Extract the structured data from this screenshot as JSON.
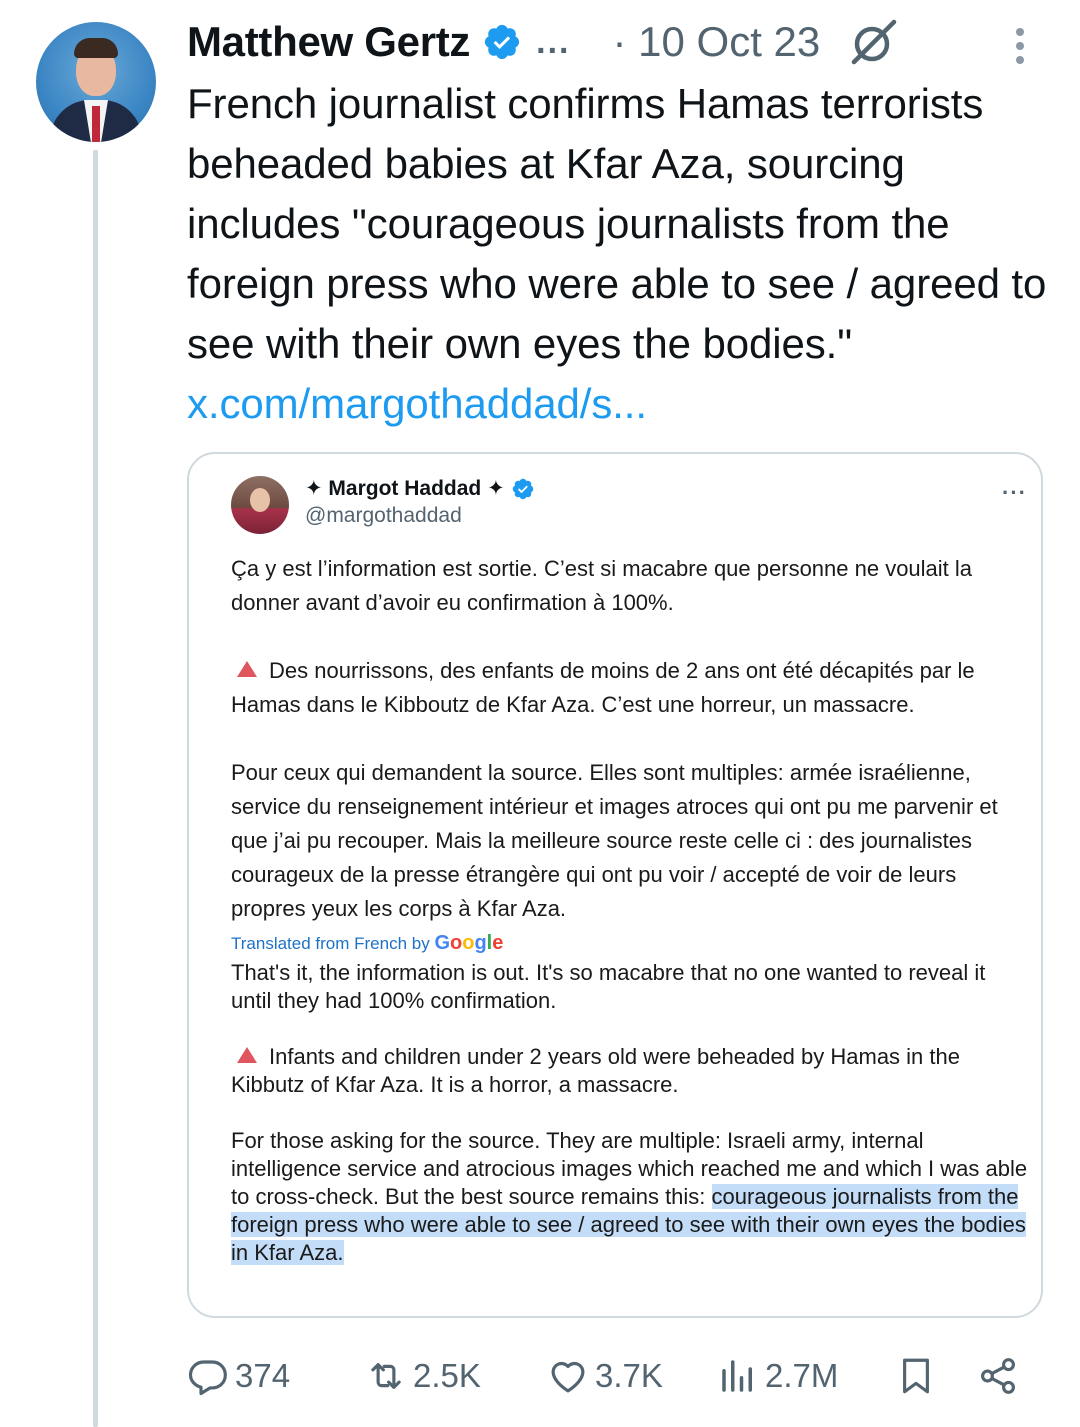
{
  "tweet": {
    "author_name": "Matthew Gertz",
    "ellipsis": "...",
    "date": "· 10 Oct 23",
    "text": "French journalist confirms Hamas terrorists beheaded babies at Kfar Aza, sourcing includes \"courageous journalists from the foreign press who were able to see / agreed to see with their own eyes the bodies.\" ",
    "link": "x.com/margothaddad/s...",
    "icons": {
      "verified": "verified-badge-icon",
      "grok": "grok-icon",
      "more": "more-vertical-icon"
    }
  },
  "quote": {
    "author_name": "✦ Margot Haddad ✦",
    "handle": "@margothaddad",
    "more": "···",
    "p1": "Ça y est l’information est sortie. C’est si macabre que personne ne voulait la donner avant d’avoir eu confirmation à 100%.",
    "p2": "Des nourrissons, des enfants de moins de 2 ans ont été décapités par le Hamas dans le Kibboutz de Kfar Aza. C’est une horreur, un massacre.",
    "p3": "Pour ceux qui demandent la source. Elles sont multiples: armée israélienne, service du renseignement intérieur et images atroces qui ont pu me parvenir et que j’ai pu recouper. Mais la meilleure source reste celle ci : des journalistes courageux de la presse étrangère qui ont pu voir / accepté de voir de leurs propres yeux les corps à Kfar Aza.",
    "translated_label": "Translated from French by ",
    "translated_brand": "Google",
    "t1": "That's it, the information is out. It's so macabre that no one wanted to reveal it until they had 100% confirmation.",
    "t2": "Infants and children under 2 years old were beheaded by Hamas in the Kibbutz of Kfar Aza. It is a horror, a massacre.",
    "t3_plain": "For those asking for the source. They are multiple: Israeli army, internal intelligence service and atrocious images which reached me and which I was able to cross-check. But the best source remains this: ",
    "t3_highlight": "courageous journalists from the foreign press who were able to see / agreed to see with their own eyes the bodies in Kfar Aza."
  },
  "actions": {
    "replies": "374",
    "reposts": "2.5K",
    "likes": "3.7K",
    "views": "2.7M"
  },
  "colors": {
    "link": "#1d9bf0",
    "verified": "#1d9bf0",
    "muted": "#536471",
    "highlight": "#c3dcf7",
    "warning": "#e0565f"
  }
}
